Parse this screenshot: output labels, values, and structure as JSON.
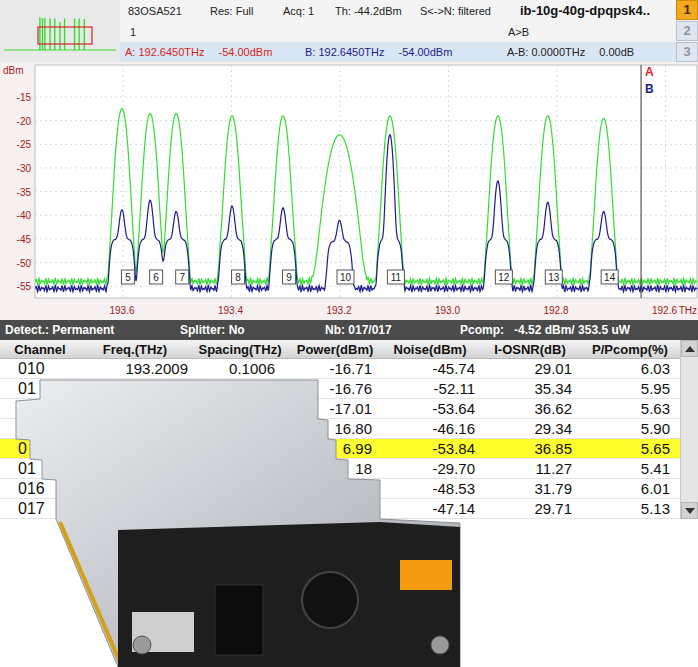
{
  "header": {
    "instrument": "83OSA521",
    "resolution": "Res: Full",
    "acquisition": "Acq: 1",
    "threshold": "Th: -44.2dBm",
    "noise_mode": "S<->N: filtered",
    "file": "ib-10g-40g-dpqpsk4..",
    "trace": "1",
    "mode": "A>B",
    "marker_a": {
      "freq": "A: 192.6450THz",
      "power": "-54.00dBm"
    },
    "marker_b": {
      "freq": "B: 192.6450THz",
      "power": "-54.00dBm"
    },
    "delta": {
      "freq": "A-B: 0.0000THz",
      "power": "0.00dB"
    }
  },
  "tabs": [
    {
      "label": "1",
      "selected": true
    },
    {
      "label": "2",
      "selected": false
    },
    {
      "label": "3",
      "selected": false
    }
  ],
  "chart": {
    "y_label": "dBm",
    "y_ticks": [
      {
        "label": "-15",
        "value": -15
      },
      {
        "label": "-20",
        "value": -20
      },
      {
        "label": "-25",
        "value": -25
      },
      {
        "label": "-30",
        "value": -30
      },
      {
        "label": "-35",
        "value": -35
      },
      {
        "label": "-40",
        "value": -40
      },
      {
        "label": "-45",
        "value": -45
      },
      {
        "label": "-50",
        "value": -50
      },
      {
        "label": "-55",
        "value": -55
      }
    ],
    "x_ticks": [
      {
        "label": "193.6",
        "value": 193.6
      },
      {
        "label": "193.4",
        "value": 193.4
      },
      {
        "label": "193.2",
        "value": 193.2
      },
      {
        "label": "193.0",
        "value": 193.0
      },
      {
        "label": "192.8",
        "value": 192.8
      },
      {
        "label": "192.6",
        "value": 192.6
      }
    ],
    "x_unit": "THz",
    "marker": {
      "thz": 192.645,
      "labels": [
        {
          "label": "A",
          "color": "#e8202a"
        },
        {
          "label": "B",
          "color": "#1c1c8c"
        }
      ]
    },
    "channels": [
      {
        "label": "5",
        "thz": 193.602
      },
      {
        "label": "6",
        "thz": 193.55
      },
      {
        "label": "7",
        "thz": 193.502
      },
      {
        "label": "8",
        "thz": 193.399
      },
      {
        "label": "9",
        "thz": 193.305
      },
      {
        "label": "10",
        "thz": 193.2009
      },
      {
        "label": "11",
        "thz": 193.108
      },
      {
        "label": "12",
        "thz": 192.909
      },
      {
        "label": "13",
        "thz": 192.817
      },
      {
        "label": "14",
        "thz": 192.714
      }
    ],
    "series": [
      {
        "color": "#33dd33",
        "floor": -54,
        "peaks": [
          -17.5,
          -18.5,
          -18.5,
          -19,
          -19,
          -23,
          -19,
          -19,
          -19,
          -19.5
        ],
        "peak_widths": [
          0.008,
          0.008,
          0.008,
          0.008,
          0.008,
          0.017,
          0.008,
          0.008,
          0.008,
          0.008
        ],
        "shoulders": [
          -45,
          -45,
          -45,
          -44,
          -44,
          -48,
          -46,
          -46,
          -46,
          -46
        ],
        "shoulder_width": 0.022
      },
      {
        "color": "#1c1c8c",
        "floor": -55.5,
        "peaks": [
          -40,
          -37.5,
          -40.5,
          -39,
          -39.5,
          -43,
          -23,
          -33,
          -38,
          -40.5
        ],
        "peak_widths": [
          0.005,
          0.005,
          0.005,
          0.005,
          0.005,
          0.005,
          0.005,
          0.005,
          0.005,
          0.005
        ],
        "shoulders": [
          -45.5,
          -45.5,
          -45.5,
          -45.5,
          -45.5,
          -46,
          -45.5,
          -45.5,
          -45.5,
          -45.5
        ],
        "shoulder_width": 0.022
      }
    ]
  },
  "status_bar": {
    "detect": "Detect.: Permanent",
    "splitter": "Splitter: No",
    "nb": "Nb: 017/017",
    "pcomp_label": "Pcomp:",
    "pcomp_value": "-4.52 dBm/ 353.5 uW"
  },
  "table": {
    "columns": [
      "Channel",
      "Freq.(THz)",
      "Spacing(THz)",
      "Power(dBm)",
      "Noise(dBm)",
      "I-OSNR(dB)",
      "P/Pcomp(%)"
    ],
    "rows": [
      {
        "cells": [
          "010",
          "193.2009",
          "0.1006",
          "-16.71",
          "-45.74",
          "29.01",
          "6.03"
        ],
        "selected": false
      },
      {
        "cells": [
          "01",
          "",
          "",
          "-16.76",
          "-52.11",
          "35.34",
          "5.95"
        ],
        "selected": false
      },
      {
        "cells": [
          "",
          "",
          "",
          "-17.01",
          "-53.64",
          "36.62",
          "5.63"
        ],
        "selected": false
      },
      {
        "cells": [
          "",
          "",
          "",
          "16.80",
          "-46.16",
          "29.34",
          "5.90"
        ],
        "selected": false
      },
      {
        "cells": [
          "0",
          "",
          "",
          "6.99",
          "-53.84",
          "36.85",
          "5.65"
        ],
        "selected": true
      },
      {
        "cells": [
          "01",
          "",
          "",
          "18",
          "-29.70",
          "11.27",
          "5.41"
        ],
        "selected": false
      },
      {
        "cells": [
          "016",
          "",
          "",
          "",
          "-48.53",
          "31.79",
          "6.01"
        ],
        "selected": false
      },
      {
        "cells": [
          "017",
          "",
          "",
          "",
          "-47.14",
          "29.71",
          "5.13"
        ],
        "selected": false
      }
    ]
  }
}
